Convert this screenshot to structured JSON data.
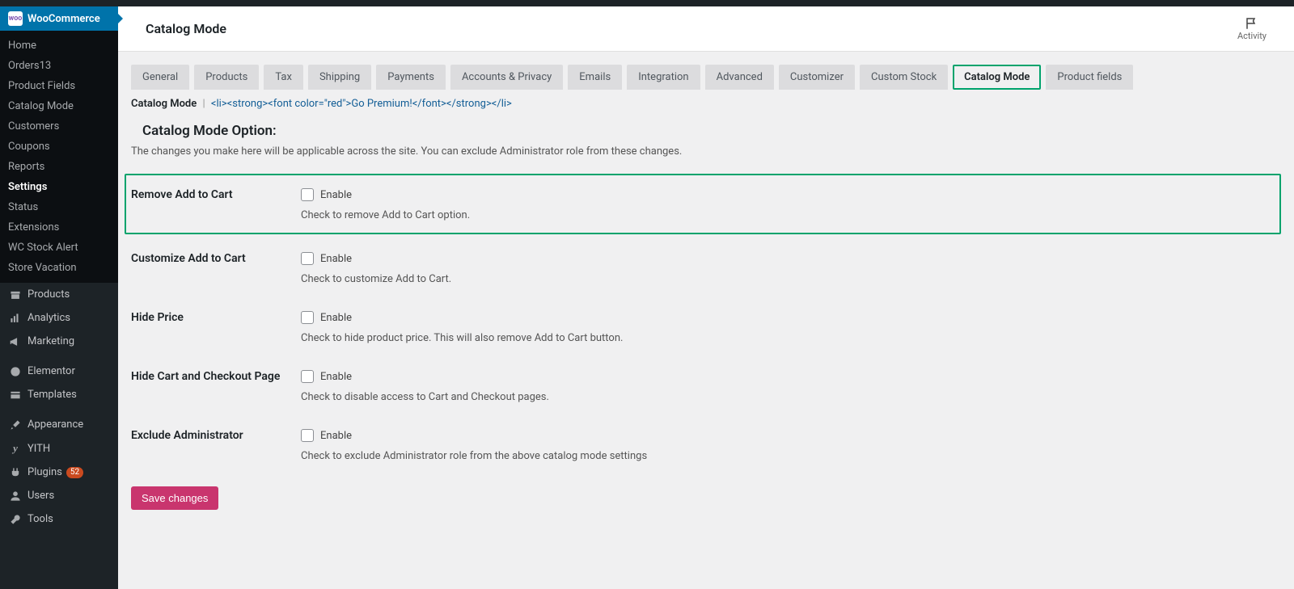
{
  "sidebar": {
    "header": "WooCommerce",
    "header_badge": "woo",
    "sub": [
      {
        "label": "Home",
        "active": false
      },
      {
        "label": "Orders",
        "active": false,
        "count": "13"
      },
      {
        "label": "Product Fields",
        "active": false
      },
      {
        "label": "Catalog Mode",
        "active": false
      },
      {
        "label": "Customers",
        "active": false
      },
      {
        "label": "Coupons",
        "active": false
      },
      {
        "label": "Reports",
        "active": false
      },
      {
        "label": "Settings",
        "active": true
      },
      {
        "label": "Status",
        "active": false
      },
      {
        "label": "Extensions",
        "active": false
      },
      {
        "label": "WC Stock Alert",
        "active": false
      },
      {
        "label": "Store Vacation",
        "active": false
      }
    ],
    "items": [
      {
        "icon": "archive-icon",
        "label": "Products"
      },
      {
        "icon": "chart-icon",
        "label": "Analytics"
      },
      {
        "icon": "megaphone-icon",
        "label": "Marketing"
      },
      {
        "spacer": true
      },
      {
        "icon": "elementor-icon",
        "label": "Elementor"
      },
      {
        "icon": "templates-icon",
        "label": "Templates"
      },
      {
        "spacer": true
      },
      {
        "icon": "brush-icon",
        "label": "Appearance"
      },
      {
        "icon": "yith-icon",
        "label": "YITH"
      },
      {
        "icon": "plugin-icon",
        "label": "Plugins",
        "count": "52"
      },
      {
        "icon": "users-icon",
        "label": "Users"
      },
      {
        "icon": "tools-icon",
        "label": "Tools"
      }
    ]
  },
  "header": {
    "title": "Catalog Mode",
    "activity_label": "Activity"
  },
  "tabs": [
    {
      "label": "General"
    },
    {
      "label": "Products"
    },
    {
      "label": "Tax"
    },
    {
      "label": "Shipping"
    },
    {
      "label": "Payments"
    },
    {
      "label": "Accounts & Privacy"
    },
    {
      "label": "Emails"
    },
    {
      "label": "Integration"
    },
    {
      "label": "Advanced"
    },
    {
      "label": "Customizer"
    },
    {
      "label": "Custom Stock"
    },
    {
      "label": "Catalog Mode",
      "active": true
    },
    {
      "label": "Product fields"
    }
  ],
  "subtabs": {
    "active_label": "Catalog Mode",
    "link_label": "<li><strong><font color=\"red\">Go Premium!</font></strong></li>"
  },
  "section": {
    "title": "Catalog Mode Option:",
    "description": "The changes you make here will be applicable across the site. You can exclude Administrator role from these changes."
  },
  "rows": {
    "remove_add_to_cart": {
      "label": "Remove Add to Cart",
      "enable": "Enable",
      "helper": "Check to remove Add to Cart option."
    },
    "customize_add_to_cart": {
      "label": "Customize Add to Cart",
      "enable": "Enable",
      "helper": "Check to customize Add to Cart."
    },
    "hide_price": {
      "label": "Hide Price",
      "enable": "Enable",
      "helper": "Check to hide product price. This will also remove Add to Cart button."
    },
    "hide_cart_checkout": {
      "label": "Hide Cart and Checkout Page",
      "enable": "Enable",
      "helper": "Check to disable access to Cart and Checkout pages."
    },
    "exclude_admin": {
      "label": "Exclude Administrator",
      "enable": "Enable",
      "helper": "Check to exclude Administrator role from the above catalog mode settings"
    }
  },
  "buttons": {
    "save": "Save changes"
  },
  "colors": {
    "highlight": "#00a36c",
    "accent": "#c9356e",
    "wp_blue": "#0073aa"
  }
}
